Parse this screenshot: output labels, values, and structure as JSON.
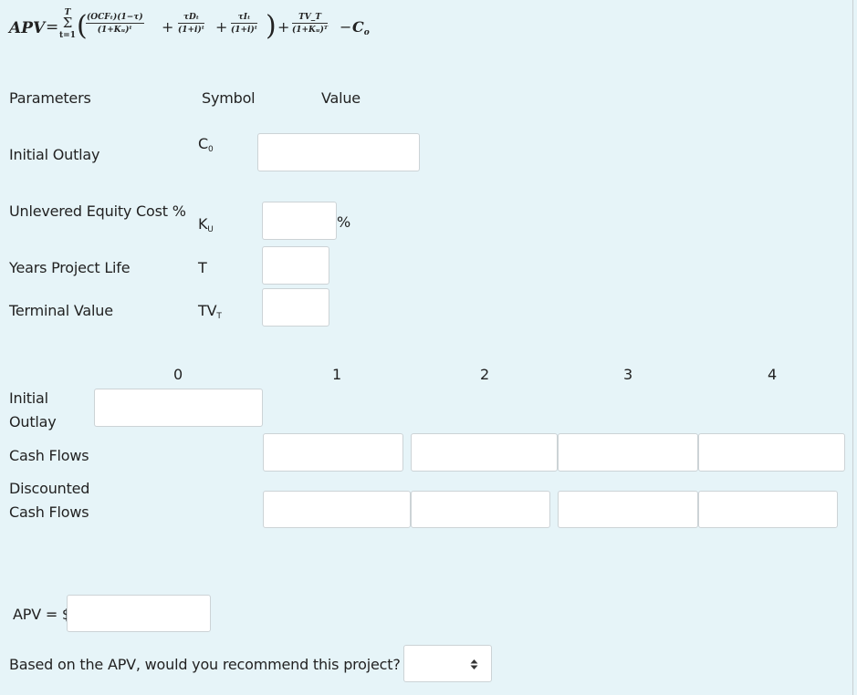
{
  "formula": {
    "lhs": "APV",
    "equals": "=",
    "sum_upper": "T",
    "sum_symbol": "Σ",
    "sum_lower": "t=1",
    "open_paren": "(",
    "close_paren": ")",
    "term1_num": "(OCFₜ)(1−τ)",
    "term1_den": "(1+Kᵤ)ᵗ",
    "plus": "+",
    "term2_num": "τDₜ",
    "term2_den": "(1+i)ᵗ",
    "term3_num": "τIₜ",
    "term3_den": "(1+i)ᵗ",
    "term4_num": "TV_T",
    "term4_den": "(1+Kᵤ)ᵀ",
    "minus": "−",
    "last": "C",
    "last_sub": "o"
  },
  "params": {
    "headers": {
      "parameters": "Parameters",
      "symbol": "Symbol",
      "value": "Value"
    },
    "rows": [
      {
        "label": "Initial Outlay",
        "symbol": "C",
        "symbol_sub": "0",
        "value": "",
        "suffix": ""
      },
      {
        "label": "Unlevered Equity Cost %",
        "symbol": "K",
        "symbol_sub": "U",
        "value": "",
        "suffix": "%"
      },
      {
        "label": "Years Project Life",
        "symbol": "T",
        "symbol_sub": "",
        "value": ""
      },
      {
        "label": "Terminal Value",
        "symbol": "TV",
        "symbol_sub": "T",
        "value": ""
      }
    ]
  },
  "cashflow": {
    "years": [
      "0",
      "1",
      "2",
      "3",
      "4"
    ],
    "rows": {
      "initial_outlay": {
        "label_line1": "Initial",
        "label_line2": "Outlay",
        "values": [
          ""
        ]
      },
      "cash_flows": {
        "label": "Cash Flows",
        "values": [
          "",
          "",
          "",
          ""
        ]
      },
      "discounted": {
        "label_line1": "Discounted",
        "label_line2": "Cash Flows",
        "values": [
          "",
          "",
          "",
          ""
        ]
      }
    }
  },
  "result": {
    "apv_label": "APV = $",
    "apv_value": "",
    "question": "Based on the APV, would you recommend this project?",
    "recommend_selected": "",
    "select_icon": "updown-arrows-icon"
  },
  "colors": {
    "background": "#e6f4f8",
    "input_border": "#ccd3d6"
  }
}
